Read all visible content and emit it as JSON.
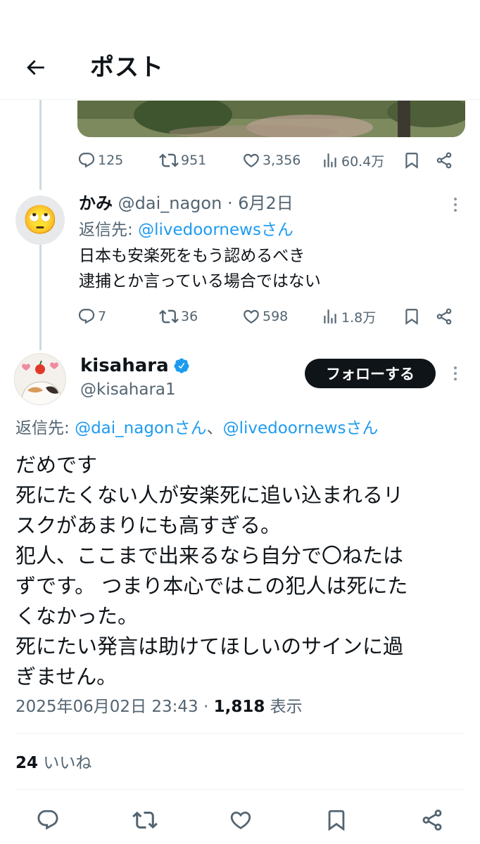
{
  "header": {
    "title": "ポスト"
  },
  "first_post": {
    "stats": {
      "replies": "125",
      "reposts": "951",
      "likes": "3,356",
      "views": "60.4万"
    }
  },
  "reply1": {
    "name": "かみ",
    "handle": "@dai_nagon",
    "date": "· 6月2日",
    "replying_to_label": "返信先: ",
    "replying_to": "@livedoornewsさん",
    "text_lines": [
      "日本も安楽死をもう認めるべき",
      "逮捕とか言っている場合ではない"
    ],
    "avatar_emoji": "🙄",
    "stats": {
      "replies": "7",
      "reposts": "36",
      "likes": "598",
      "views": "1.8万"
    }
  },
  "main": {
    "name": "kisahara",
    "handle": "@kisahara1",
    "follow_label": "フォローする",
    "replying_to_label": "返信先: ",
    "replying_to_1": "@dai_nagonさん",
    "replying_to_sep": "、",
    "replying_to_2": "@livedoornewsさん",
    "text_lines": [
      "だめです",
      "死にたくない人が安楽死に追い込まれるリ",
      "スクがあまりにも高すぎる。",
      "犯人、ここまで出来るなら自分で〇ねたは",
      "ずです。 つまり本心ではこの犯人は死にた",
      "くなかった。",
      "死にたい発言は助けてほしいのサインに過",
      "ぎません。"
    ],
    "timestamp": "2025年06月02日 23:43 · ",
    "views_count": "1,818",
    "views_label": " 表示",
    "likes_count": "24",
    "likes_label": " いいね"
  },
  "colors": {
    "accent": "#1d9bf0",
    "text": "#0f1419",
    "muted": "#536471",
    "verified": "#1d9bf0"
  }
}
